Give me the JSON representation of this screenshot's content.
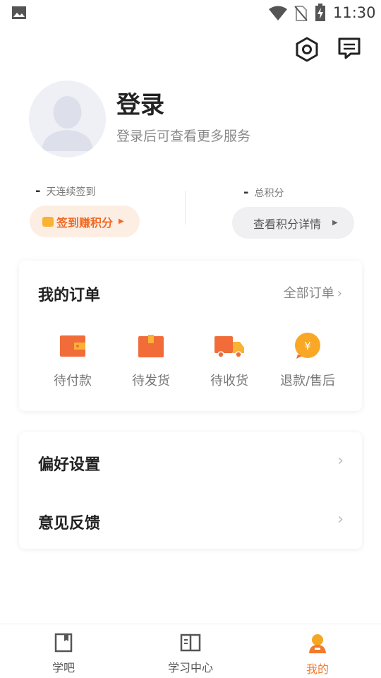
{
  "status_bar": {
    "time": "11:30"
  },
  "profile": {
    "title": "登录",
    "subtitle": "登录后可查看更多服务"
  },
  "stats": {
    "checkin_value": "-",
    "checkin_label": "天连续签到",
    "points_value": "-",
    "points_label": "总积分",
    "checkin_button": "签到赚积分",
    "points_button": "查看积分详情"
  },
  "orders": {
    "title": "我的订单",
    "all_label": "全部订单",
    "items": [
      {
        "label": "待付款",
        "icon": "wallet-icon"
      },
      {
        "label": "待发货",
        "icon": "package-icon"
      },
      {
        "label": "待收货",
        "icon": "truck-icon"
      },
      {
        "label": "退款/售后",
        "icon": "refund-icon"
      }
    ]
  },
  "settings": {
    "items": [
      {
        "label": "偏好设置"
      },
      {
        "label": "意见反馈"
      }
    ]
  },
  "bottom_nav": {
    "items": [
      {
        "label": "学吧",
        "active": false
      },
      {
        "label": "学习中心",
        "active": false
      },
      {
        "label": "我的",
        "active": true
      }
    ]
  },
  "colors": {
    "accent": "#f07a2e",
    "orange": "#f26c3a"
  }
}
